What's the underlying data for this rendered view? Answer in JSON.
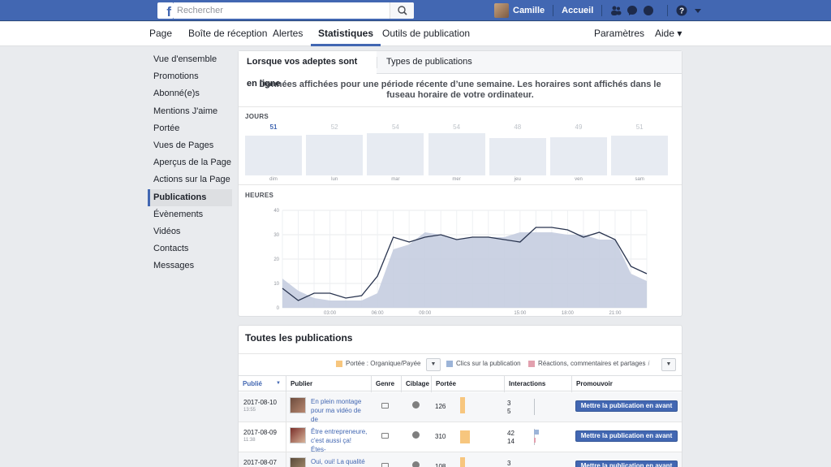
{
  "topbar": {
    "search_placeholder": "Rechercher",
    "user_name": "Camille",
    "home_label": "Accueil",
    "icons": [
      "friends-icon",
      "messenger-icon",
      "globe-icon",
      "help-icon",
      "caret-down-icon"
    ]
  },
  "page_nav": {
    "tabs": [
      {
        "label": "Page"
      },
      {
        "label": "Boîte de réception"
      },
      {
        "label": "Alertes"
      },
      {
        "label": "Statistiques",
        "active": true
      },
      {
        "label": "Outils de publication"
      }
    ],
    "settings_label": "Paramètres",
    "help_label": "Aide ▾"
  },
  "left_menu": [
    {
      "label": "Vue d'ensemble"
    },
    {
      "label": "Promotions"
    },
    {
      "label": "Abonné(e)s"
    },
    {
      "label": "Mentions J'aime"
    },
    {
      "label": "Portée"
    },
    {
      "label": "Vues de Pages"
    },
    {
      "label": "Aperçus de la Page"
    },
    {
      "label": "Actions sur la Page"
    },
    {
      "label": "Publications",
      "active": true
    },
    {
      "label": "Évènements"
    },
    {
      "label": "Vidéos"
    },
    {
      "label": "Contacts"
    },
    {
      "label": "Messages"
    }
  ],
  "insights": {
    "tabs": [
      "Lorsque vos adeptes sont en ligne",
      "Types de publications"
    ],
    "note": "Données affichées pour une période récente d’une semaine. Les horaires sont affichés dans le fuseau horaire de votre ordinateur.",
    "days_label": "JOURS",
    "hours_label": "HEURES"
  },
  "days_data": [
    {
      "label": "dim",
      "value": "51",
      "highlight": true
    },
    {
      "label": "lun",
      "value": "52"
    },
    {
      "label": "mar",
      "value": "54"
    },
    {
      "label": "mer",
      "value": "54"
    },
    {
      "label": "jeu",
      "value": "48"
    },
    {
      "label": "ven",
      "value": "49"
    },
    {
      "label": "sam",
      "value": "51"
    }
  ],
  "chart_data": {
    "type": "area",
    "x": [
      0,
      1,
      2,
      3,
      4,
      5,
      6,
      7,
      8,
      9,
      10,
      11,
      12,
      13,
      14,
      15,
      16,
      17,
      18,
      19,
      20,
      21,
      22,
      23
    ],
    "x_tick_labels": [
      {
        "x": 3,
        "label": "03:00"
      },
      {
        "x": 6,
        "label": "06:00"
      },
      {
        "x": 9,
        "label": "09:00"
      },
      {
        "x": 15,
        "label": "15:00"
      },
      {
        "x": 18,
        "label": "18:00"
      },
      {
        "x": 21,
        "label": "21:00"
      }
    ],
    "ylim": [
      0,
      40
    ],
    "y_ticks": [
      0,
      10,
      20,
      30,
      40
    ],
    "grid": true,
    "series": [
      {
        "kind": "area",
        "color": "#c5cde0",
        "values": [
          12,
          7,
          4,
          3,
          3,
          3,
          6,
          24,
          26,
          31,
          30,
          28,
          29,
          29,
          29,
          31,
          31,
          31,
          30,
          30,
          28,
          28,
          14,
          11
        ]
      },
      {
        "kind": "line",
        "color": "#29344f",
        "values": [
          8,
          3,
          6,
          6,
          4,
          5,
          13,
          29,
          27,
          29,
          30,
          28,
          29,
          29,
          28,
          27,
          33,
          33,
          32,
          29,
          31,
          28,
          17,
          14
        ]
      }
    ]
  },
  "publications": {
    "title": "Toutes les publications",
    "legend": [
      {
        "label": "Portée : Organique/Payée",
        "color": "#f7c67e"
      },
      {
        "label": "Clics sur la publication",
        "color": "#9cb4d8"
      },
      {
        "label": "Réactions, commentaires et partages",
        "color": "#e2a0ae"
      }
    ],
    "info_icon": "i",
    "dropdown_glyph": "▼",
    "columns": [
      "Publié",
      "Publier",
      "Genre",
      "Ciblage",
      "Portée",
      "Interactions",
      "Promouvoir"
    ],
    "sort_glyph": "▼",
    "promote_label": "Mettre la publication en avant",
    "rows": [
      {
        "date": "2017-08-10",
        "time": "13:55",
        "title": "En plein montage pour ma vidéo de de",
        "reach": "126",
        "clicks": "3",
        "reactions": "5"
      },
      {
        "date": "2017-08-09",
        "time": "11:38",
        "title": "Être entrepreneure, c'est aussi ça! Étes-",
        "reach": "310",
        "clicks": "42",
        "reactions": "14"
      },
      {
        "date": "2017-08-07",
        "time": "",
        "title": "Oui, oui! La qualité",
        "reach": "108",
        "clicks": "3",
        "reactions": ""
      }
    ]
  }
}
